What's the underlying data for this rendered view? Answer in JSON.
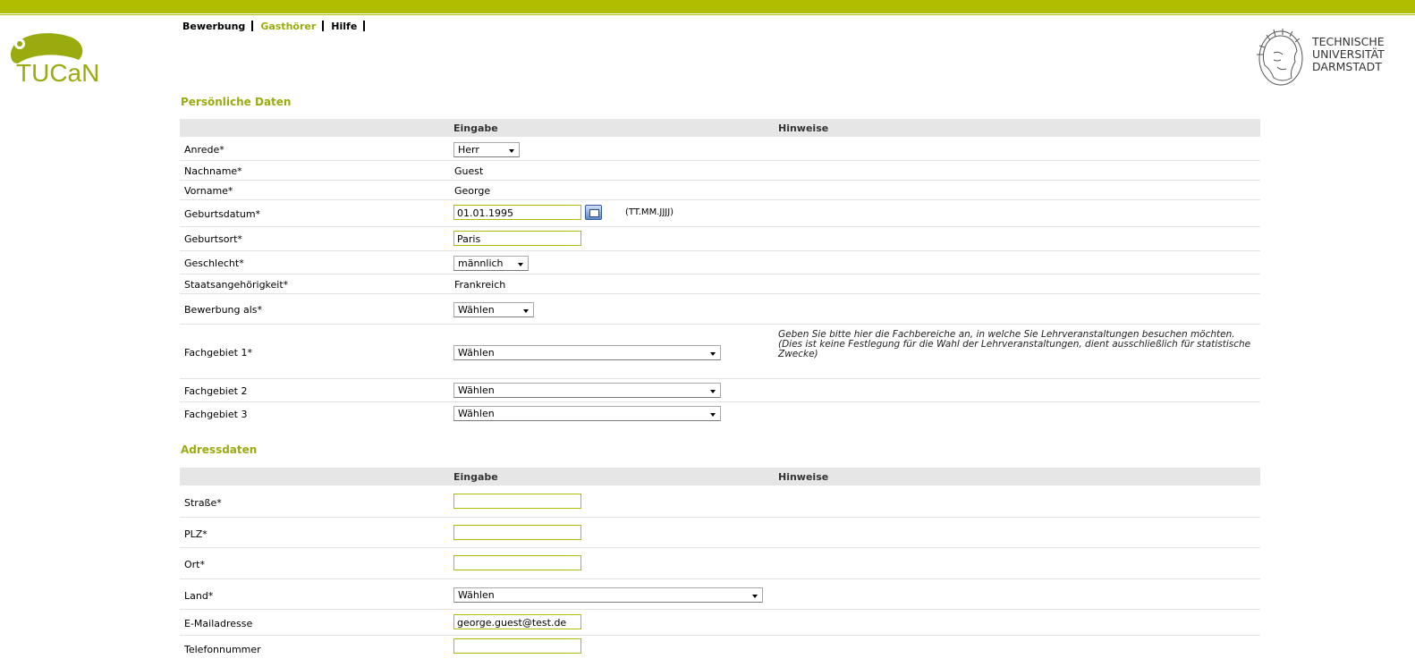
{
  "header": {
    "logo_text": "TUCaN",
    "nav": [
      "Bewerbung",
      "Gasthörer",
      "Hilfe"
    ],
    "active_nav": "Gasthörer",
    "university": [
      "TECHNISCHE",
      "UNIVERSITÄT",
      "DARMSTADT"
    ]
  },
  "personal": {
    "title": "Persönliche Daten",
    "col_input": "Eingabe",
    "col_hint": "Hinweise",
    "rows": [
      {
        "label": "Anrede*",
        "value": "Herr"
      },
      {
        "label": "Nachname*",
        "value": "Guest"
      },
      {
        "label": "Vorname*",
        "value": "George"
      },
      {
        "label": "Geburtsdatum*",
        "value": "01.01.1995",
        "format_hint": "(TT.MM.JJJJ)"
      },
      {
        "label": "Geburtsort*",
        "value": "Paris"
      },
      {
        "label": "Geschlecht*",
        "value": "männlich"
      },
      {
        "label": "Staatsangehörigkeit*",
        "value": "Frankreich"
      },
      {
        "label": "Bewerbung als*",
        "value": "Wählen"
      },
      {
        "label": "Fachgebiet 1*",
        "value": "Wählen",
        "hint": "Geben Sie bitte hier die Fachbereiche an, in welche Sie Lehrveranstaltungen besuchen möchten. (Dies ist keine Festlegung für die Wahl der Lehrveranstaltungen, dient ausschließlich für statistische Zwecke)"
      },
      {
        "label": "Fachgebiet 2",
        "value": "Wählen"
      },
      {
        "label": "Fachgebiet 3",
        "value": "Wählen"
      }
    ]
  },
  "address": {
    "title": "Adressdaten",
    "col_input": "Eingabe",
    "col_hint": "Hinweise",
    "rows": [
      {
        "label": "Straße*",
        "value": ""
      },
      {
        "label": "PLZ*",
        "value": ""
      },
      {
        "label": "Ort*",
        "value": ""
      },
      {
        "label": "Land*",
        "value": "Wählen"
      },
      {
        "label": "E-Mailadresse",
        "value": "george.guest@test.de"
      },
      {
        "label": "Telefonnummer",
        "value": ""
      }
    ]
  },
  "colors": {
    "accent": "#b1bd00",
    "accent_text": "#9aab0f",
    "header_bg": "#e6e6e6"
  }
}
